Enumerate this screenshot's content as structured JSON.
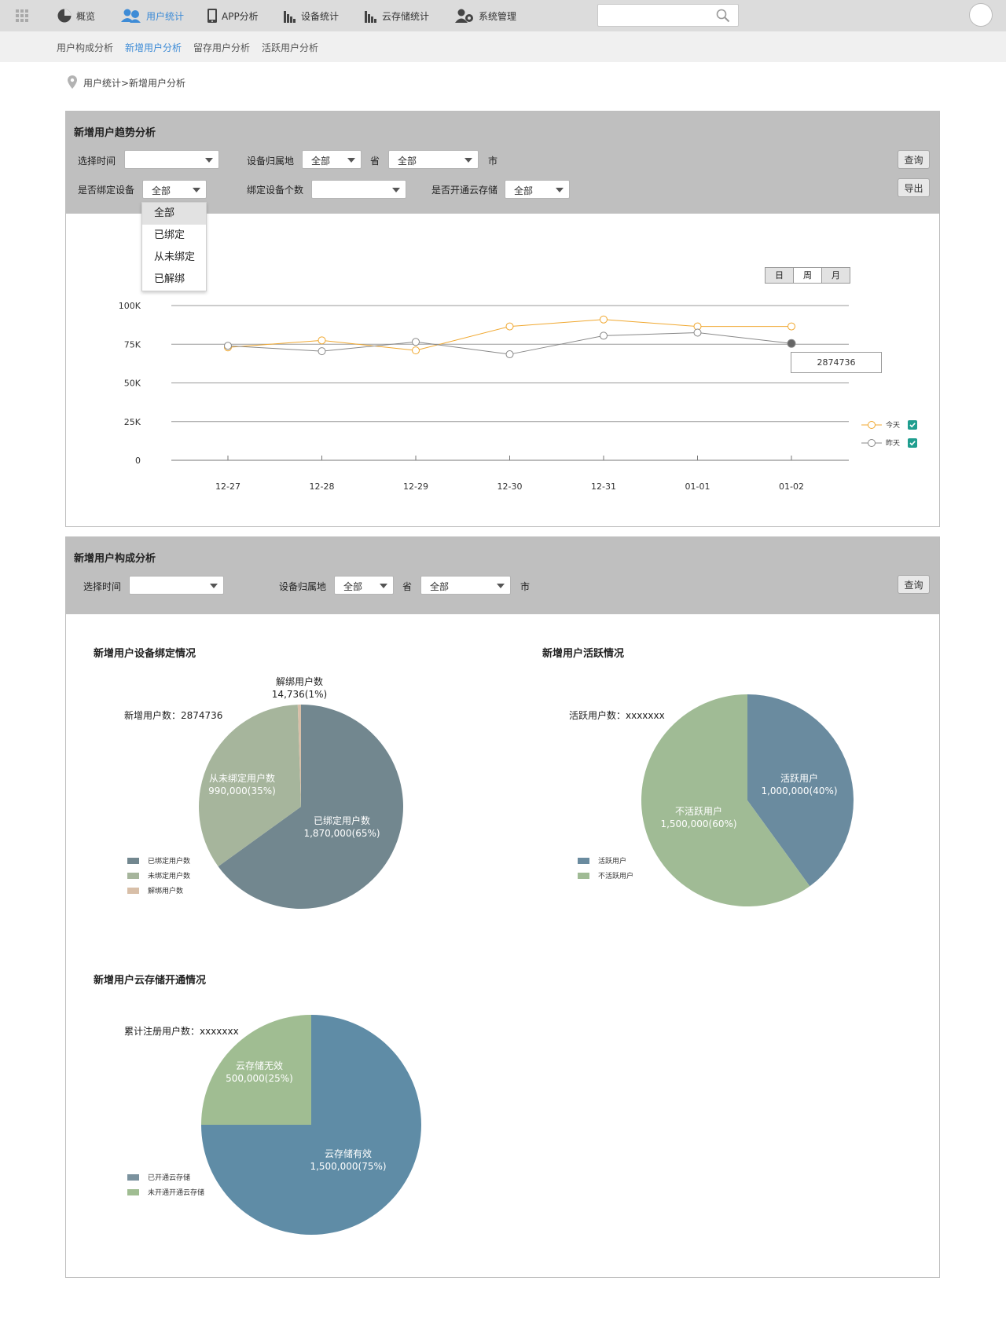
{
  "nav": {
    "items": [
      {
        "label": "概览",
        "icon": "pie-chart-icon",
        "active": false
      },
      {
        "label": "用户统计",
        "icon": "users-icon",
        "active": true
      },
      {
        "label": "APP分析",
        "icon": "phone-icon",
        "active": false
      },
      {
        "label": "设备统计",
        "icon": "bar-chart-icon",
        "active": false
      },
      {
        "label": "云存储统计",
        "icon": "bar-chart-icon",
        "active": false
      },
      {
        "label": "系统管理",
        "icon": "user-settings-icon",
        "active": false
      }
    ],
    "search_placeholder": ""
  },
  "subnav": {
    "items": [
      {
        "label": "用户构成分析",
        "active": false
      },
      {
        "label": "新增用户分析",
        "active": true
      },
      {
        "label": "留存用户分析",
        "active": false
      },
      {
        "label": "活跃用户分析",
        "active": false
      }
    ]
  },
  "breadcrumb": "用户统计>新增用户分析",
  "trend_panel": {
    "title": "新增用户趋势分析",
    "time_label": "选择时间",
    "time_value": "",
    "region_label": "设备归属地",
    "province_value": "全部",
    "province_unit": "省",
    "city_value": "全部",
    "city_unit": "市",
    "bound_label": "是否绑定设备",
    "bound_value": "全部",
    "device_count_label": "绑定设备个数",
    "device_count_value": "",
    "cloud_label": "是否开通云存储",
    "cloud_value": "全部",
    "query_button": "查询",
    "export_button": "导出",
    "dropdown_options": [
      "全部",
      "已绑定",
      "从未绑定",
      "已解绑"
    ],
    "dropdown_selected": "全部",
    "period_toggle": [
      "日",
      "周",
      "月"
    ],
    "period_selected": "日",
    "tooltip_value": "2874736",
    "legend": [
      {
        "name": "今天",
        "color": "#f0a830",
        "checked": true
      },
      {
        "name": "昨天",
        "color": "#888888",
        "checked": true
      }
    ]
  },
  "chart_data": [
    {
      "type": "line",
      "x": [
        "12-27",
        "12-28",
        "12-29",
        "12-30",
        "12-31",
        "01-01",
        "01-02"
      ],
      "yticks": [
        "0",
        "25K",
        "50K",
        "75K",
        "100K"
      ],
      "ylim": [
        0,
        100000
      ],
      "grid": true,
      "legend_position": "right",
      "series": [
        {
          "name": "今天",
          "color": "#f0a830",
          "values": [
            73000,
            77500,
            71000,
            86500,
            91000,
            86500,
            86500
          ]
        },
        {
          "name": "昨天",
          "color": "#888888",
          "values": [
            74000,
            70500,
            76500,
            68500,
            80500,
            82500,
            75500
          ]
        }
      ]
    },
    {
      "type": "pie",
      "title": "新增用户设备绑定情况",
      "slices": [
        {
          "name": "已绑定用户数",
          "value": 1870000,
          "percent": 65,
          "label": "1,870,000(65%)",
          "color": "#72878f"
        },
        {
          "name": "从未绑定用户数",
          "value": 990000,
          "percent": 35,
          "label": "990,000(35%)",
          "color": "#a6b59c"
        },
        {
          "name": "解绑用户数",
          "value": 14736,
          "percent": 1,
          "label": "14,736(1%)",
          "color": "#d8bfa8"
        }
      ],
      "legend": [
        "已绑定用户数",
        "未绑定用户数",
        "解绑用户数"
      ]
    },
    {
      "type": "pie",
      "title": "新增用户活跃情况",
      "slices": [
        {
          "name": "活跃用户",
          "value": 1000000,
          "percent": 40,
          "label": "1,000,000(40%)",
          "color": "#6a8b9f"
        },
        {
          "name": "不活跃用户",
          "value": 1500000,
          "percent": 60,
          "label": "1,500,000(60%)",
          "color": "#a0bb95"
        }
      ],
      "legend": [
        "活跃用户",
        "不活跃用户"
      ]
    },
    {
      "type": "pie",
      "title": "新增用户云存储开通情况",
      "slices": [
        {
          "name": "云存储有效",
          "value": 1500000,
          "percent": 75,
          "label": "1,500,000(75%)",
          "color": "#5f8ca6"
        },
        {
          "name": "云存储无效",
          "value": 500000,
          "percent": 25,
          "label": "500,000(25%)",
          "color": "#a0bd92"
        }
      ],
      "legend": [
        "已开通云存储",
        "未开通开通云存储"
      ]
    }
  ],
  "composition_panel": {
    "title": "新增用户构成分析",
    "time_label": "选择时间",
    "time_value": "",
    "region_label": "设备归属地",
    "province_value": "全部",
    "province_unit": "省",
    "city_value": "全部",
    "city_unit": "市",
    "query_button": "查询",
    "binding": {
      "title": "新增用户设备绑定情况",
      "count_text": "新增用户数：2874736"
    },
    "active": {
      "title": "新增用户活跃情况",
      "count_text": "活跃用户数：xxxxxxx"
    },
    "cloud": {
      "title": "新增用户云存储开通情况",
      "count_text": "累计注册用户数：xxxxxxx"
    }
  }
}
